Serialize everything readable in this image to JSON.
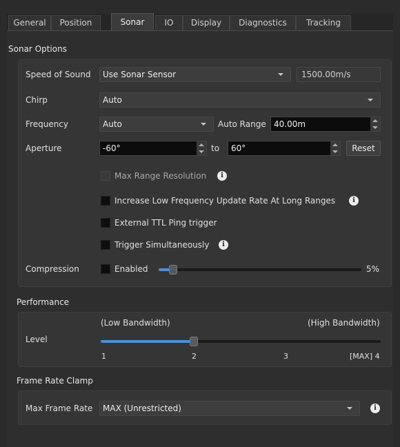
{
  "tabs": [
    {
      "label": "General"
    },
    {
      "label": "Position"
    },
    {
      "label": "Sonar",
      "active": true
    },
    {
      "label": "IO"
    },
    {
      "label": "Display"
    },
    {
      "label": "Diagnostics"
    },
    {
      "label": "Tracking"
    }
  ],
  "sonar_options": {
    "title": "Sonar Options",
    "speed_of_sound": {
      "label": "Speed of Sound",
      "mode": "Use Sonar Sensor",
      "value": "1500.00m/s"
    },
    "chirp": {
      "label": "Chirp",
      "value": "Auto"
    },
    "frequency": {
      "label": "Frequency",
      "value": "Auto",
      "auto_range_label": "Auto Range",
      "auto_range_value": "40.00m"
    },
    "aperture": {
      "label": "Aperture",
      "from": "-60°",
      "to_label": "to",
      "to": "60°",
      "reset_label": "Reset"
    },
    "max_range_resolution": {
      "label": "Max Range Resolution",
      "enabled": false
    },
    "increase_low_freq": {
      "label": "Increase Low Frequency Update Rate At Long Ranges",
      "checked": false
    },
    "external_ttl": {
      "label": "External TTL Ping trigger",
      "checked": false
    },
    "trigger_simultaneously": {
      "label": "Trigger Simultaneously",
      "checked": false
    },
    "compression": {
      "label": "Compression",
      "enabled_label": "Enabled",
      "checked": false,
      "value_text": "5%",
      "level": 0.05
    }
  },
  "performance": {
    "title": "Performance",
    "level_label": "Level",
    "low_label": "(Low Bandwidth)",
    "high_label": "(High Bandwidth)",
    "ticks": [
      "1",
      "2",
      "3",
      "[MAX] 4"
    ],
    "value": 2,
    "min": 1,
    "max": 4
  },
  "frame_rate_clamp": {
    "title": "Frame Rate Clamp",
    "label": "Max Frame Rate",
    "value": "MAX (Unrestricted)"
  },
  "icons": {
    "info": "info-icon",
    "dropdown": "chevron-down-icon",
    "spin": "spinner-arrows-icon"
  },
  "colors": {
    "accent": "#4a90d9",
    "background": "#2b2b2b",
    "input_dark": "#0c0c0c"
  }
}
